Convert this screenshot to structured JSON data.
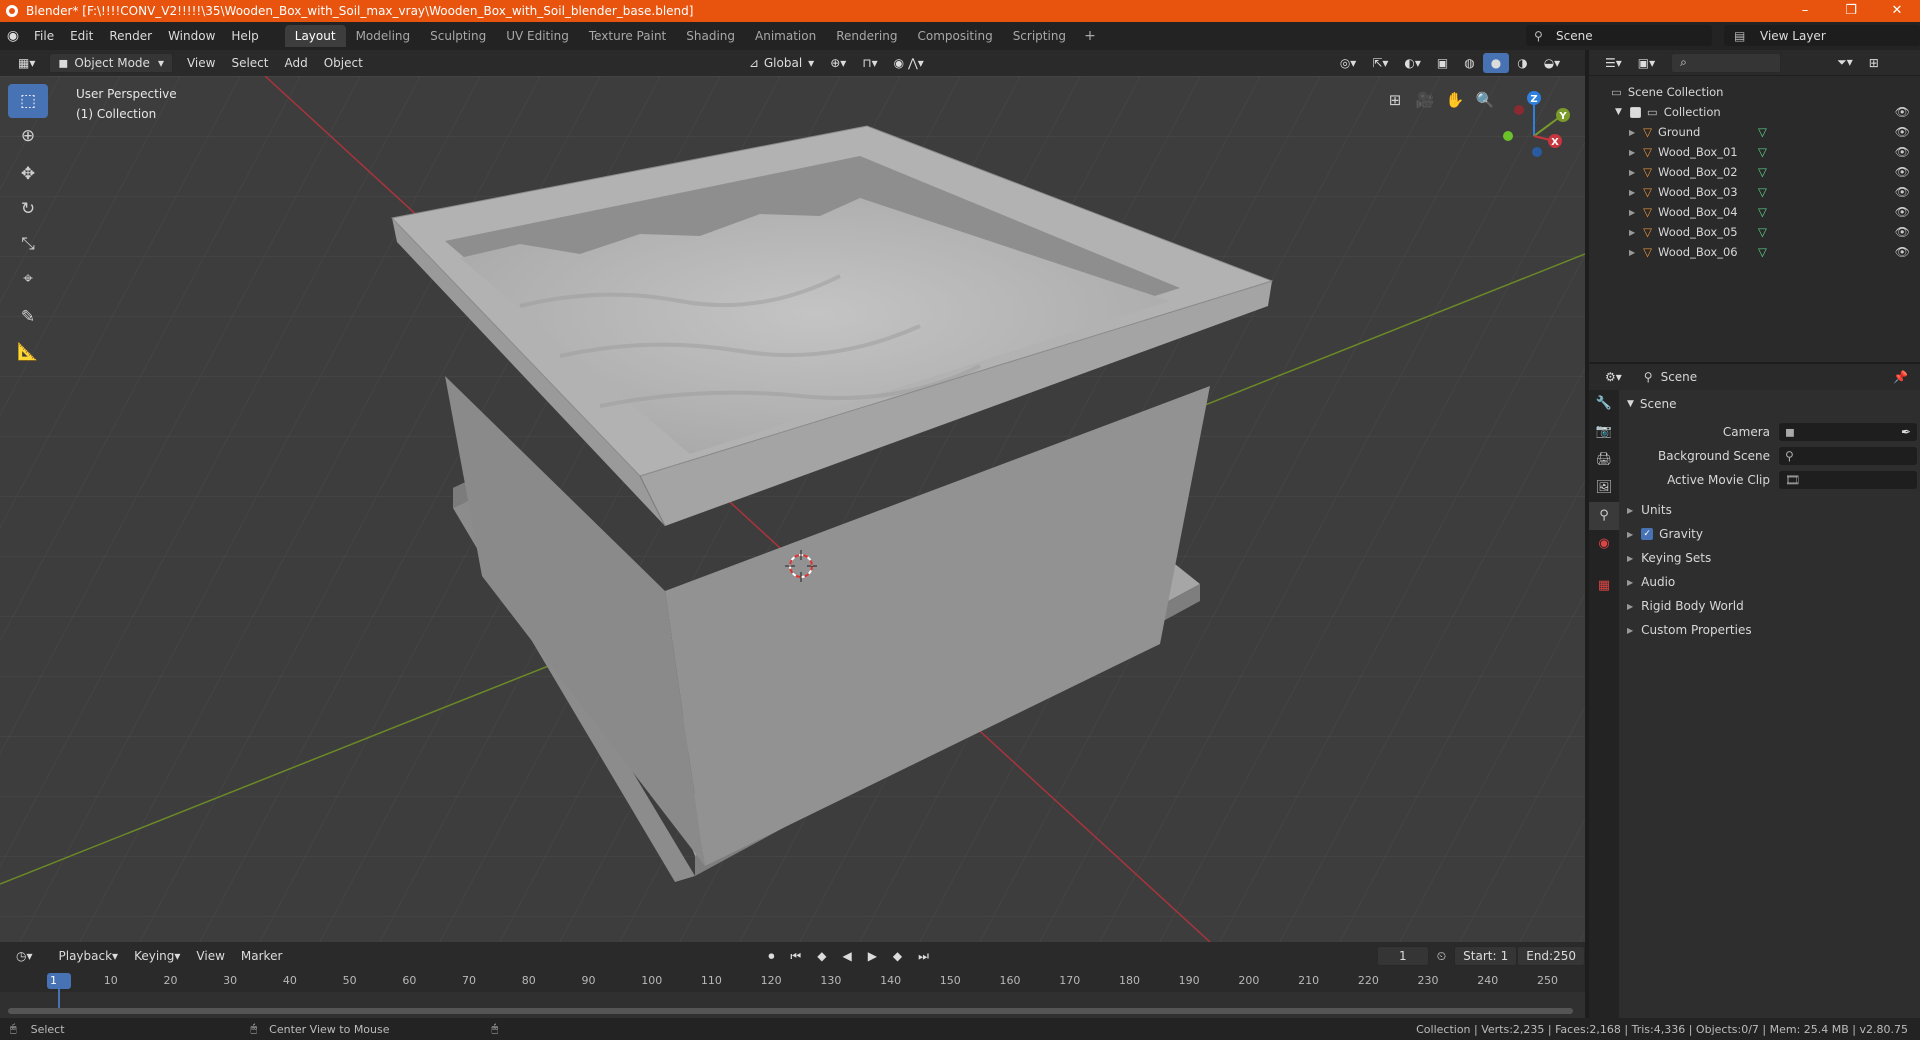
{
  "window": {
    "title": "Blender* [F:\\!!!!CONV_V2!!!!!\\35\\Wooden_Box_with_Soil_max_vray\\Wooden_Box_with_Soil_blender_base.blend]",
    "minimize": "–",
    "maximize": "❐",
    "close": "✕"
  },
  "menu": [
    "File",
    "Edit",
    "Render",
    "Window",
    "Help"
  ],
  "workspaces": [
    "Layout",
    "Modeling",
    "Sculpting",
    "UV Editing",
    "Texture Paint",
    "Shading",
    "Animation",
    "Rendering",
    "Compositing",
    "Scripting"
  ],
  "workspace_add": "+",
  "scene_name": "Scene",
  "view_layer": "View Layer",
  "viewport_header": {
    "mode": "Object Mode",
    "menus": [
      "View",
      "Select",
      "Add",
      "Object"
    ],
    "orientation": "Global"
  },
  "viewport": {
    "perspective": "User Perspective",
    "collection": "(1) Collection",
    "gizmo_x": "X",
    "gizmo_y": "Y",
    "gizmo_z": "Z"
  },
  "outliner": {
    "scene_collection": "Scene Collection",
    "collection": "Collection",
    "objects": [
      "Ground",
      "Wood_Box_01",
      "Wood_Box_02",
      "Wood_Box_03",
      "Wood_Box_04",
      "Wood_Box_05",
      "Wood_Box_06"
    ]
  },
  "properties": {
    "context": "Scene",
    "panel_title": "Scene",
    "camera_label": "Camera",
    "background_scene_label": "Background Scene",
    "active_movie_clip_label": "Active Movie Clip",
    "sections": [
      "Units",
      "Gravity",
      "Keying Sets",
      "Audio",
      "Rigid Body World",
      "Custom Properties"
    ]
  },
  "timeline": {
    "menus": [
      "Playback",
      "Keying",
      "View",
      "Marker"
    ],
    "current_frame": "1",
    "start_label": "Start:",
    "start": "1",
    "end_label": "End:",
    "end": "250",
    "ticks": [
      "1",
      "10",
      "20",
      "30",
      "40",
      "50",
      "60",
      "70",
      "80",
      "90",
      "100",
      "110",
      "120",
      "130",
      "140",
      "150",
      "160",
      "170",
      "180",
      "190",
      "200",
      "210",
      "220",
      "230",
      "240",
      "250"
    ]
  },
  "status": {
    "left_action": "Select",
    "middle_action": "Center View to Mouse",
    "stats": "Collection | Verts:2,235 | Faces:2,168 | Tris:4,336 | Objects:0/7 | Mem: 25.4 MB | v2.80.75"
  },
  "colors": {
    "title_bar": "#e8530e",
    "active_tool": "#4772b3",
    "x_axis": "#c8353f",
    "y_axis": "#7a9a2a",
    "z_axis": "#2f7fdc"
  }
}
